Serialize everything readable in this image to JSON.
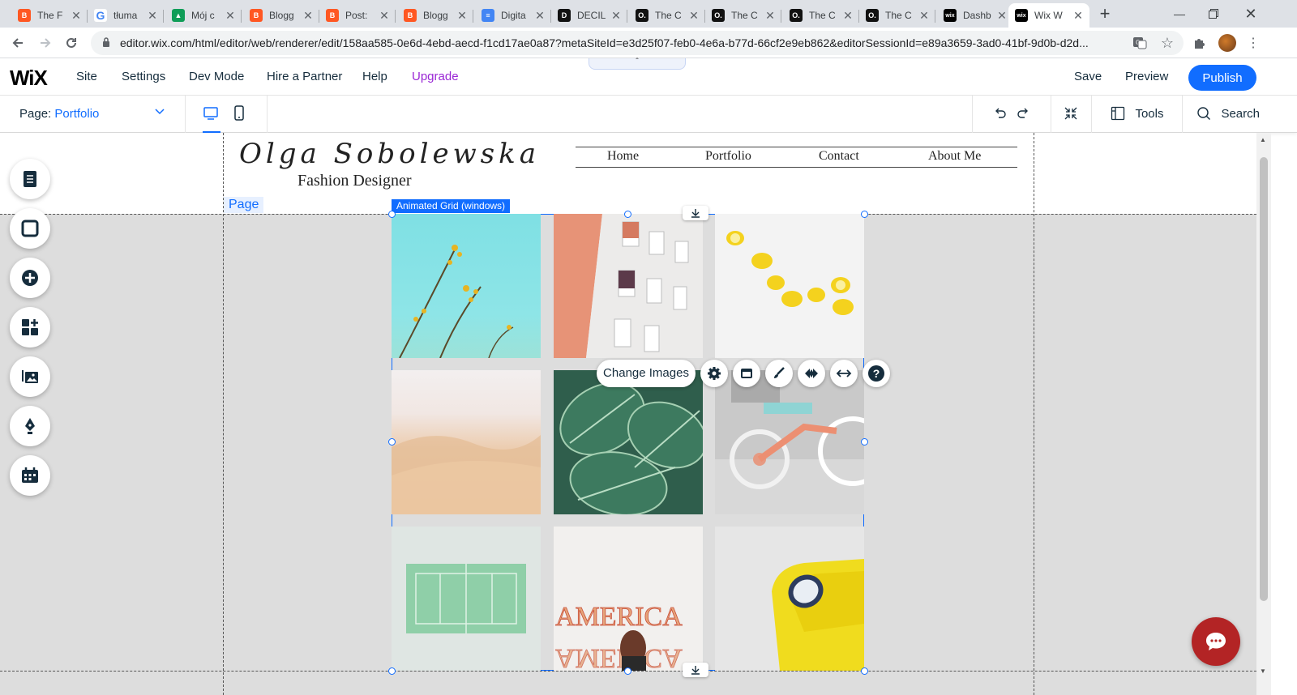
{
  "browser": {
    "tabs": [
      {
        "title": "The F",
        "favicon": "blogger",
        "color": "#ff5722"
      },
      {
        "title": "tłuma",
        "favicon": "google",
        "color": "#4285f4"
      },
      {
        "title": "Mój c",
        "favicon": "drive",
        "color": "#0f9d58"
      },
      {
        "title": "Blogg",
        "favicon": "blogger",
        "color": "#ff5722"
      },
      {
        "title": "Post:",
        "favicon": "blogger",
        "color": "#ff5722"
      },
      {
        "title": "Blogg",
        "favicon": "blogger",
        "color": "#ff5722"
      },
      {
        "title": "Digita",
        "favicon": "docs",
        "color": "#4285f4"
      },
      {
        "title": "DECIL",
        "favicon": "d-logo",
        "color": "#111111"
      },
      {
        "title": "The C",
        "favicon": "o-logo",
        "color": "#111111"
      },
      {
        "title": "The C",
        "favicon": "o-logo",
        "color": "#111111"
      },
      {
        "title": "The C",
        "favicon": "o-logo",
        "color": "#111111"
      },
      {
        "title": "The C",
        "favicon": "o-logo",
        "color": "#111111"
      },
      {
        "title": "Dashb",
        "favicon": "wix",
        "color": "#000000"
      },
      {
        "title": "Wix W",
        "favicon": "wix",
        "color": "#000000",
        "active": true
      }
    ],
    "favicon_letters": {
      "google": "G",
      "d-logo": "D",
      "o-logo": "O.",
      "wix": "wix",
      "blogger": "B",
      "drive": "▲",
      "docs": "≡"
    },
    "url": "editor.wix.com/html/editor/web/renderer/edit/158aa585-0e6d-4ebd-aecd-f1cd17ae0a87?metaSiteId=e3d25f07-feb0-4e6a-b77d-66cf2e9eb862&editorSessionId=e89a3659-3ad0-41bf-9d0b-d2d..."
  },
  "wix_topbar": {
    "logo": "WiX",
    "menu": [
      "Site",
      "Settings",
      "Dev Mode",
      "Hire a Partner",
      "Help"
    ],
    "upgrade": "Upgrade",
    "save": "Save",
    "preview": "Preview",
    "publish": "Publish"
  },
  "pagebar": {
    "page_prefix": "Page:",
    "page_name": "Portfolio",
    "tools": "Tools",
    "search": "Search"
  },
  "site": {
    "name": "Olga Sobolewska",
    "subtitle": "Fashion Designer",
    "nav": [
      "Home",
      "Portfolio",
      "Contact",
      "About Me"
    ]
  },
  "editor": {
    "page_label": "Page",
    "selection_label": "Animated Grid (windows)",
    "change_images": "Change Images"
  },
  "grid_images": [
    "flowers-sky",
    "building-facade",
    "lemons",
    "desert-dunes",
    "striped-leaves",
    "bicycle",
    "tennis-court",
    "america-sign",
    "yellow-sofa"
  ],
  "colors": {
    "wix_blue": "#116dff",
    "upgrade_purple": "#9a27d5",
    "chat_red": "#b32425"
  }
}
